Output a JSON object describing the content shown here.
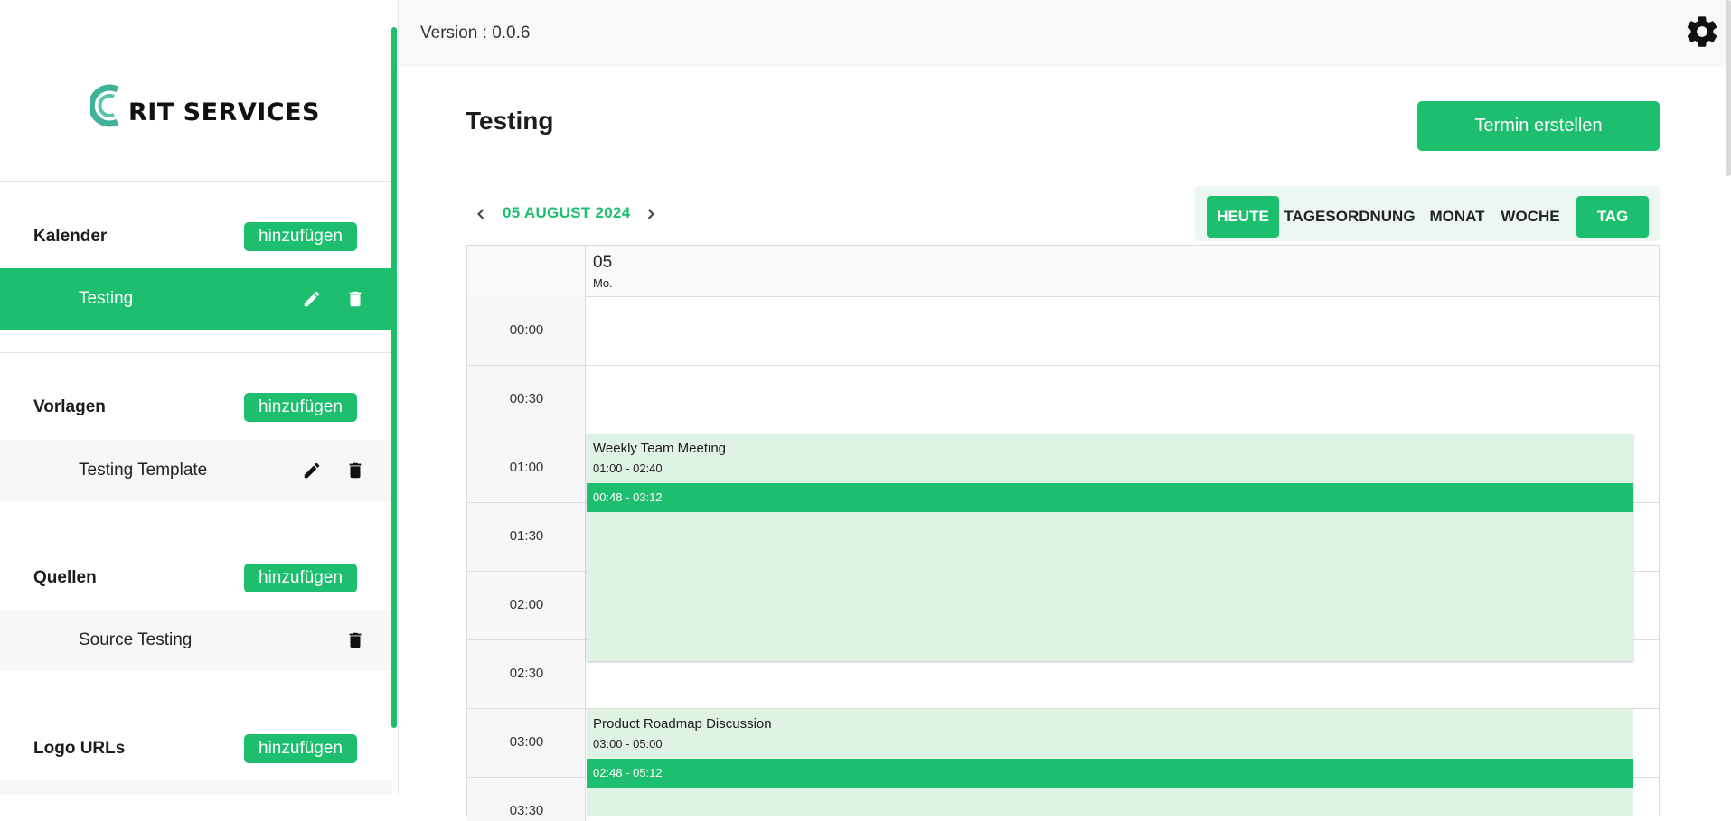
{
  "app": {
    "logo_text": "RIT SERVICES",
    "version": "Version : 0.0.6",
    "page_title": "Testing",
    "create_button": "Termin erstellen",
    "colors": {
      "accent": "#1ebe6f",
      "event_bg": "#dff3e4",
      "sidebar_item_bg": "#f7f7f7"
    }
  },
  "sidebar": {
    "add_label": "hinzufügen",
    "sections": [
      {
        "title": "Kalender",
        "item": "Testing",
        "active": true,
        "icons": [
          "pencil-icon",
          "trash-icon"
        ]
      },
      {
        "title": "Vorlagen",
        "item": "Testing Template",
        "active": false,
        "icons": [
          "pencil-icon",
          "trash-icon"
        ]
      },
      {
        "title": "Quellen",
        "item": "Source Testing",
        "active": false,
        "icons": [
          "trash-icon"
        ]
      },
      {
        "title": "Logo URLs"
      }
    ]
  },
  "toolbar": {
    "date": "05 AUGUST 2024",
    "views": [
      "HEUTE",
      "TAGESORDNUNG",
      "MONAT",
      "WOCHE",
      "TAG"
    ],
    "active_views": [
      "HEUTE",
      "TAG"
    ]
  },
  "calendar": {
    "day_number": "05",
    "day_name": "Mo.",
    "times": [
      "00:00",
      "00:30",
      "01:00",
      "01:30",
      "02:00",
      "02:30",
      "03:00",
      "03:30"
    ],
    "events": [
      {
        "title": "Weekly Team Meeting",
        "time": "01:00 - 02:40",
        "buffer": "00:48 - 03:12"
      },
      {
        "title": "Product Roadmap Discussion",
        "time": "03:00 - 05:00",
        "buffer": "02:48 - 05:12"
      }
    ]
  }
}
